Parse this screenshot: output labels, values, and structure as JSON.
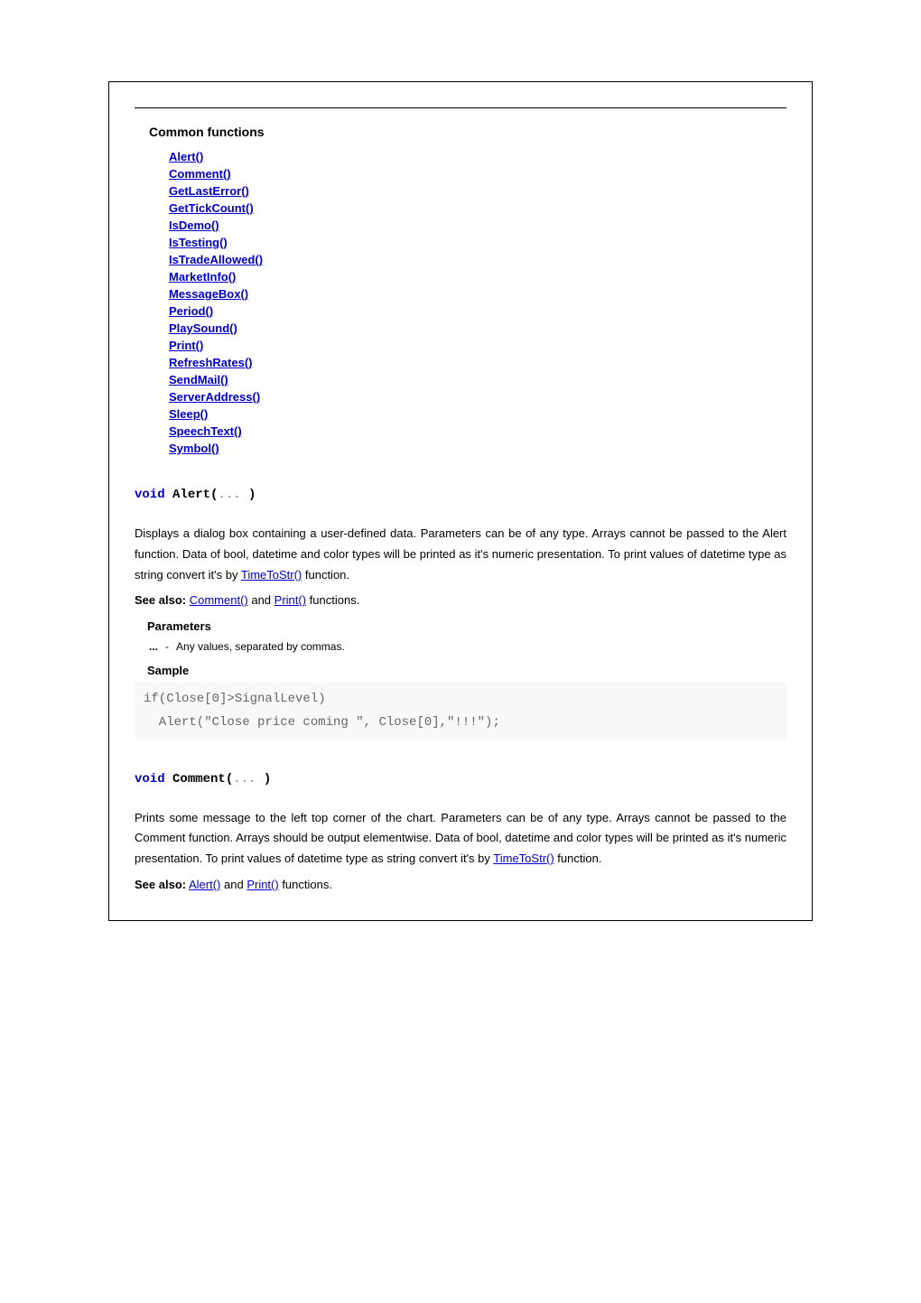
{
  "toc": {
    "title": "Common functions",
    "items": [
      "Alert()",
      "Comment()",
      "GetLastError()",
      "GetTickCount()",
      "IsDemo()",
      "IsTesting()",
      "IsTradeAllowed()",
      "MarketInfo()",
      "MessageBox()",
      "Period()",
      "PlaySound()",
      "Print()",
      "RefreshRates()",
      "SendMail()",
      "ServerAddress()",
      "Sleep()",
      "SpeechText()",
      "Symbol()"
    ]
  },
  "alert": {
    "sig_void": "void",
    "sig_name": " Alert(",
    "sig_args": "... ",
    "sig_close": ")",
    "desc_pre": "Displays a dialog box containing a user-defined data. Parameters can be of any type. Arrays cannot be passed to the Alert function. Data of bool, datetime and color types will be printed as it's numeric presentation. To print values of datetime type as string convert it's by ",
    "desc_link": "TimeToStr()",
    "desc_post": " function.",
    "see_also_label": "See also:",
    "see_also_pre": " ",
    "see_also_link1": "Comment()",
    "see_also_mid": " and ",
    "see_also_link2": "Print()",
    "see_also_post": " functions.",
    "params_head": "Parameters",
    "param_name": "...",
    "param_sep": "-",
    "param_desc": "Any values, separated by commas.",
    "sample_head": "Sample",
    "code": "if(Close[0]>SignalLevel)\n  Alert(\"Close price coming \", Close[0],\"!!!\");"
  },
  "comment": {
    "sig_void": "void",
    "sig_name": " Comment(",
    "sig_args": "... ",
    "sig_close": ")",
    "desc_pre": "Prints some message to the left top corner of the chart. Parameters can be of any type. Arrays cannot be passed to the Comment function. Arrays should be output elementwise. Data of bool, datetime and color types will be printed as it's numeric presentation. To print values of datetime type as string convert it's by ",
    "desc_link": "TimeToStr()",
    "desc_post": " function.",
    "see_also_label": "See also:",
    "see_also_pre": " ",
    "see_also_link1": "Alert()",
    "see_also_mid": " and ",
    "see_also_link2": "Print()",
    "see_also_post": " functions."
  }
}
